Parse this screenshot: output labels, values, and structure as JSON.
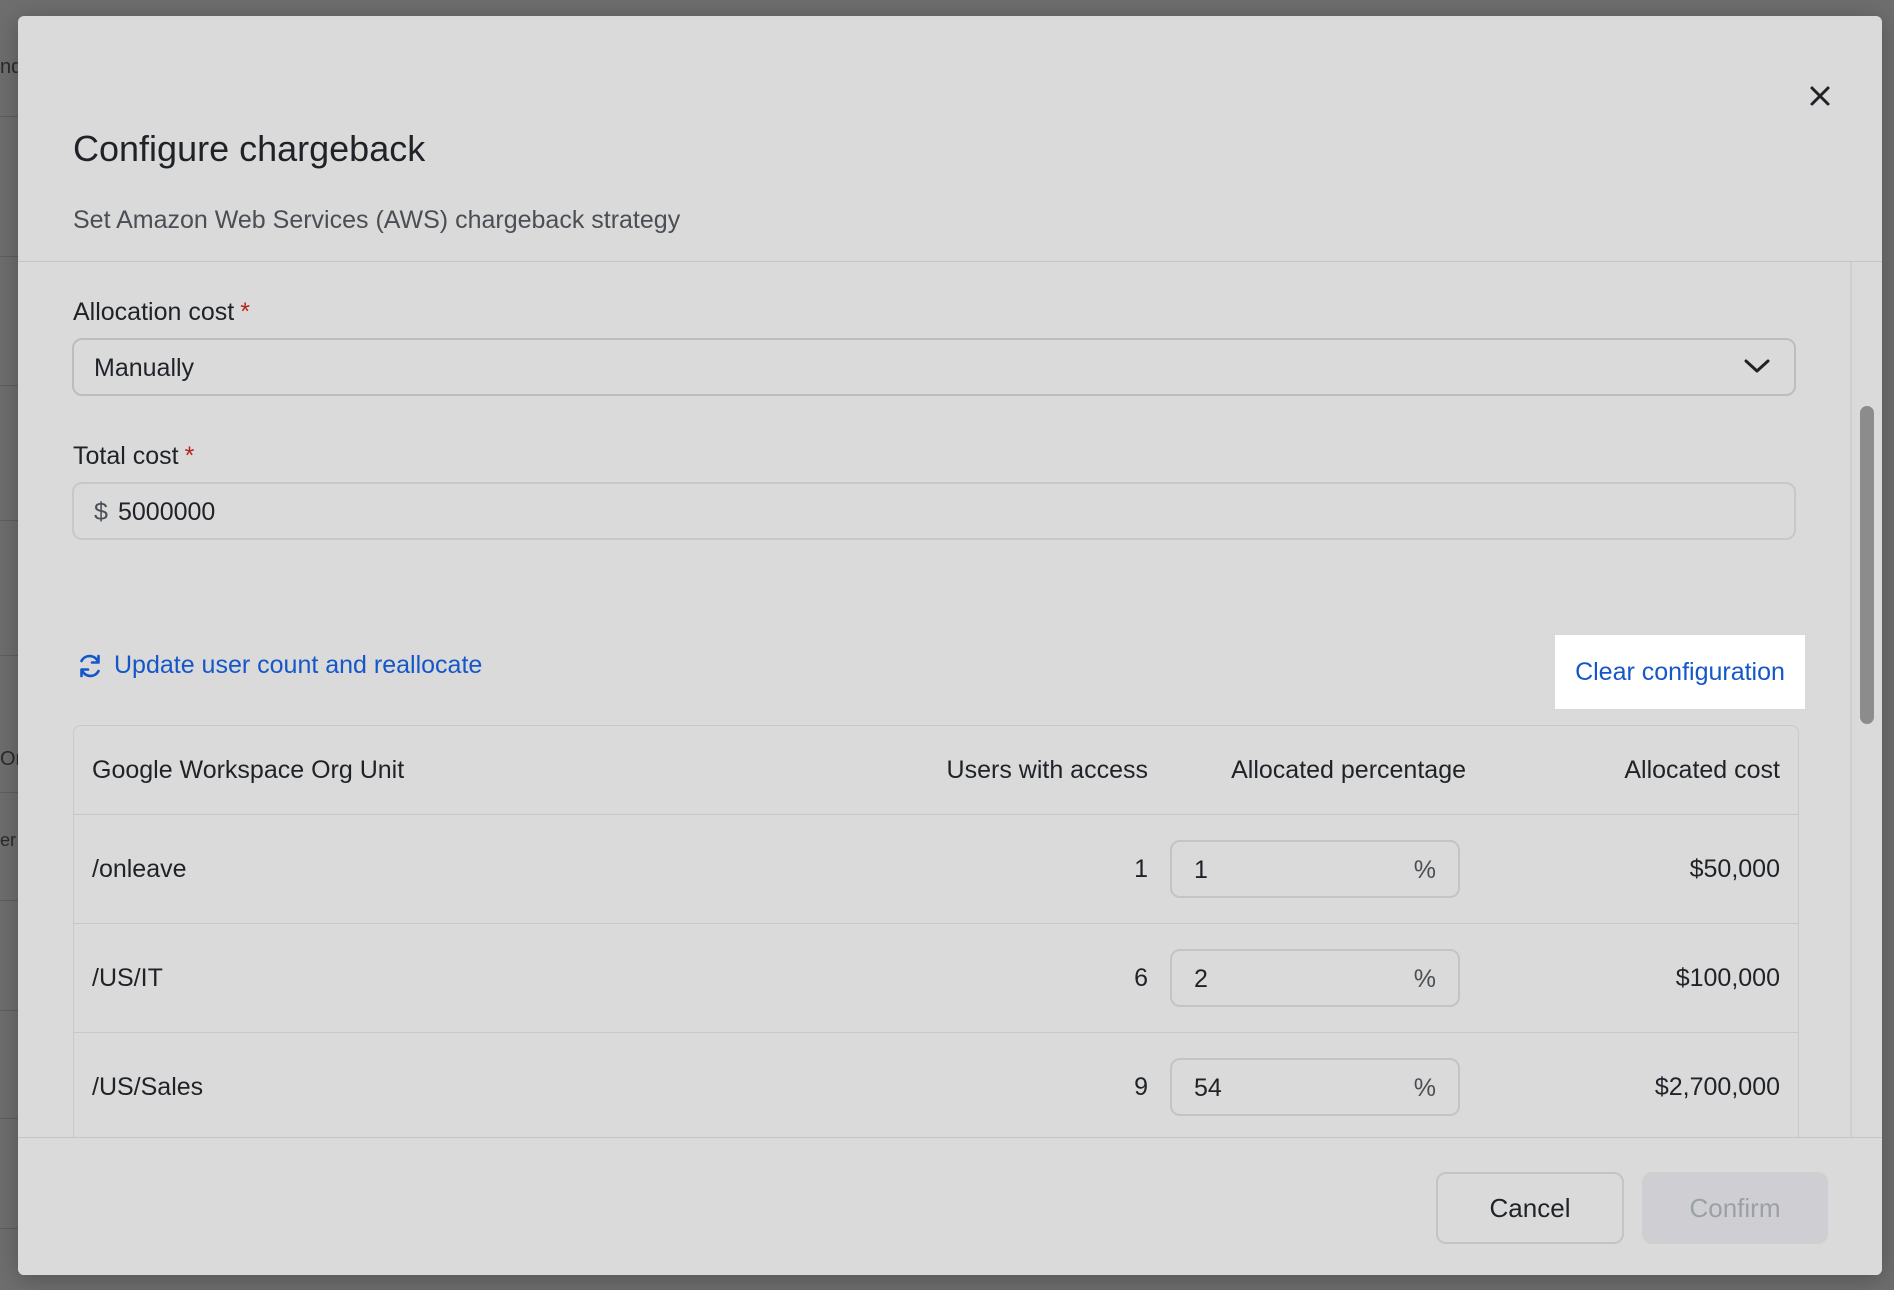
{
  "background": {
    "fragments": [
      "nd",
      "Or",
      "er"
    ]
  },
  "modal": {
    "title": "Configure chargeback",
    "subtitle": "Set Amazon Web Services (AWS) chargeback strategy",
    "close_icon": "close-icon"
  },
  "allocation": {
    "label": "Allocation cost",
    "required_mark": "*",
    "value": "Manually",
    "icon": "chevron-down-icon"
  },
  "total_cost": {
    "label": "Total cost",
    "required_mark": "*",
    "currency": "$",
    "value": "5000000"
  },
  "actions": {
    "update_label": "Update user count and reallocate",
    "update_icon": "refresh-icon",
    "clear_label": "Clear configuration"
  },
  "table": {
    "headers": {
      "org": "Google Workspace Org Unit",
      "users": "Users with access",
      "pct": "Allocated percentage",
      "cost": "Allocated cost"
    },
    "rows": [
      {
        "org": "/onleave",
        "users": "1",
        "pct": "1",
        "pct_symbol": "%",
        "cost": "$50,000"
      },
      {
        "org": "/US/IT",
        "users": "6",
        "pct": "2",
        "pct_symbol": "%",
        "cost": "$100,000"
      },
      {
        "org": "/US/Sales",
        "users": "9",
        "pct": "54",
        "pct_symbol": "%",
        "cost": "$2,700,000"
      }
    ]
  },
  "footer": {
    "cancel": "Cancel",
    "confirm": "Confirm"
  },
  "colors": {
    "link": "#1457c8",
    "required": "#b3261e",
    "disabled_text": "#9aa0a6"
  }
}
